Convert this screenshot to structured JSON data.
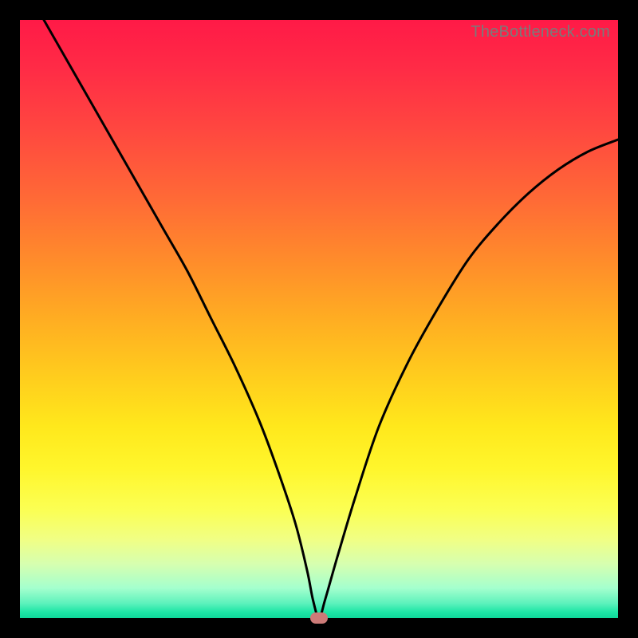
{
  "watermark": "TheBottleneck.com",
  "colors": {
    "frame": "#000000",
    "gradient_top": "#ff1a47",
    "gradient_bottom": "#0fd89a",
    "curve": "#000000",
    "marker": "#cd7b78"
  },
  "chart_data": {
    "type": "line",
    "title": "",
    "xlabel": "",
    "ylabel": "",
    "xlim": [
      0,
      100
    ],
    "ylim": [
      0,
      100
    ],
    "marker": {
      "x": 50,
      "y": 0
    },
    "series": [
      {
        "name": "curve",
        "x": [
          4,
          8,
          12,
          16,
          20,
          24,
          28,
          32,
          36,
          40,
          43,
          46,
          48,
          49,
          50,
          51,
          53,
          56,
          60,
          65,
          70,
          75,
          80,
          85,
          90,
          95,
          100
        ],
        "y": [
          100,
          93,
          86,
          79,
          72,
          65,
          58,
          50,
          42,
          33,
          25,
          16,
          8,
          3,
          0,
          3,
          10,
          20,
          32,
          43,
          52,
          60,
          66,
          71,
          75,
          78,
          80
        ]
      }
    ]
  }
}
